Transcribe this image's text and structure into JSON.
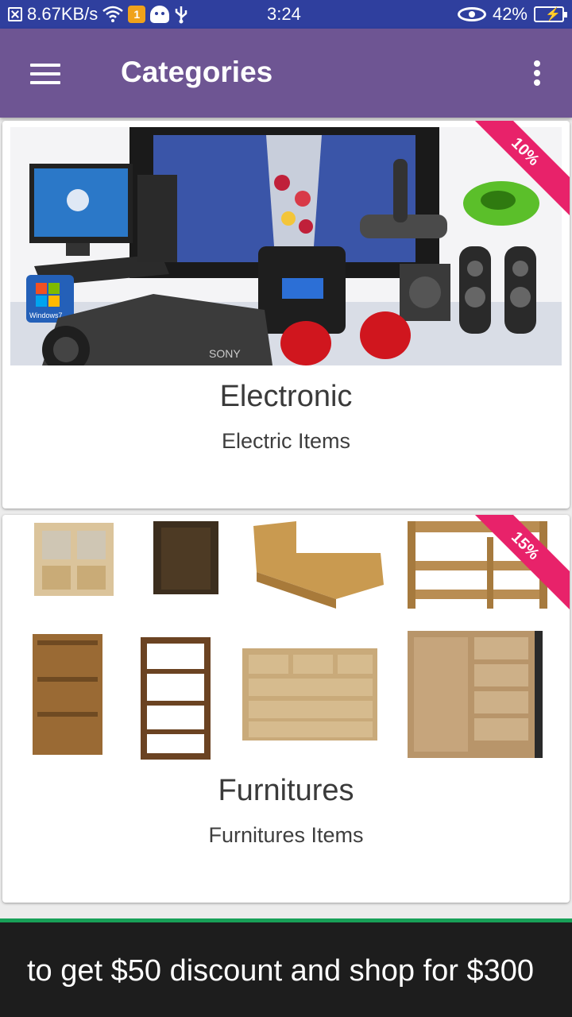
{
  "status_bar": {
    "speed": "8.67KB/s",
    "time": "3:24",
    "battery": "42%",
    "battery_level": 0.42
  },
  "app_bar": {
    "title": "Categories"
  },
  "categories": [
    {
      "title": "Electronic",
      "subtitle": "Electric Items",
      "discount": "10%",
      "image_text": "Windows7"
    },
    {
      "title": "Furnitures",
      "subtitle": "Furnitures Items",
      "discount": "15%"
    }
  ],
  "banner": {
    "text": "to get $50 discount and shop for $300"
  },
  "colors": {
    "status_bar": "#2f3f9e",
    "app_bar": "#6e5593",
    "ribbon": "#e8226a",
    "banner_bg": "#1d1d1d",
    "banner_accent": "#18a058"
  }
}
